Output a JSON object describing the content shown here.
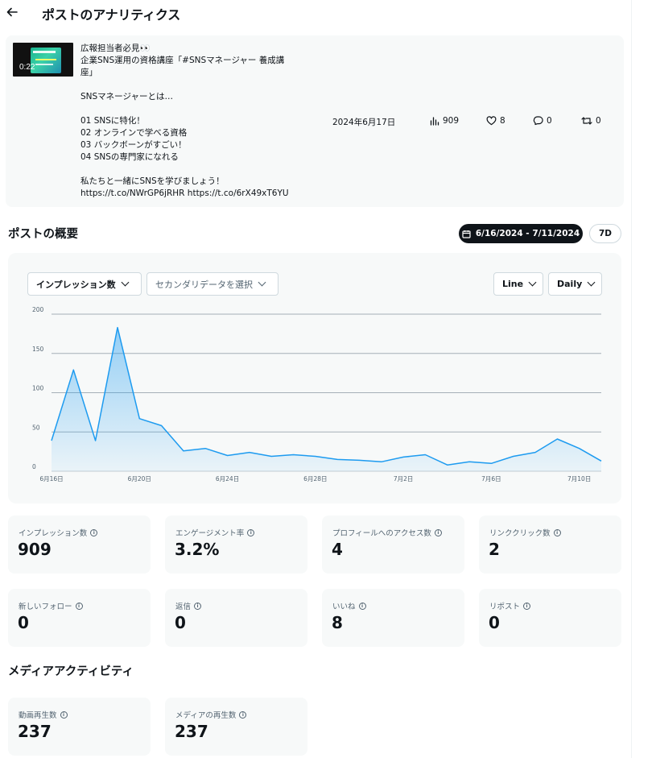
{
  "header": {
    "title": "ポストのアナリティクス"
  },
  "post": {
    "video_duration": "0:22",
    "text": "広報担当者必見👀\n企業SNS運用の資格講座「#SNSマネージャー 養成講\n座」\n\nSNSマネージャーとは…\n\n01 SNSに特化！\n02 オンラインで学べる資格\n03 バックボーンがすごい！\n04 SNSの専門家になれる\n\n私たちと一緒にSNSを学びましょう！\nhttps://t.co/NWrGP6jRHR https://t.co/6rX49xT6YU",
    "date": "2024年6月17日",
    "views": "909",
    "likes": "8",
    "replies": "0",
    "reposts": "0"
  },
  "overview": {
    "title": "ポストの概要",
    "date_range": "6/16/2024 - 7/11/2024",
    "range_button": "7D",
    "primary_metric": "インプレッション数",
    "secondary_placeholder": "セカンダリデータを選択",
    "chart_type_label": "Line",
    "interval_label": "Daily"
  },
  "chart_data": {
    "type": "area",
    "x": [
      "6月16日",
      "6月17日",
      "6月18日",
      "6月19日",
      "6月20日",
      "6月21日",
      "6月22日",
      "6月23日",
      "6月24日",
      "6月25日",
      "6月26日",
      "6月27日",
      "6月28日",
      "6月29日",
      "6月30日",
      "7月1日",
      "7月2日",
      "7月3日",
      "7月4日",
      "7月5日",
      "7月6日",
      "7月7日",
      "7月8日",
      "7月9日",
      "7月10日",
      "7月11日"
    ],
    "tick_labels": [
      "6月16日",
      "6月20日",
      "6月24日",
      "6月28日",
      "7月2日",
      "7月6日",
      "7月10日"
    ],
    "tick_indices": [
      0,
      4,
      8,
      12,
      16,
      20,
      24
    ],
    "values": [
      39,
      129,
      39,
      183,
      67,
      58,
      26,
      29,
      20,
      24,
      19,
      21,
      19,
      15,
      14,
      12,
      18,
      21,
      8,
      12,
      10,
      19,
      24,
      41,
      29,
      13
    ],
    "ylim": [
      0,
      200
    ],
    "y_ticks": [
      0,
      50,
      100,
      150,
      200
    ],
    "grid": true,
    "color": "#1d9bf0"
  },
  "metrics": [
    {
      "label": "インプレッション数",
      "value": "909"
    },
    {
      "label": "エンゲージメント率",
      "value": "3.2%"
    },
    {
      "label": "プロフィールへのアクセス数",
      "value": "4"
    },
    {
      "label": "リンククリック数",
      "value": "2"
    },
    {
      "label": "新しいフォロー",
      "value": "0"
    },
    {
      "label": "返信",
      "value": "0"
    },
    {
      "label": "いいね",
      "value": "8"
    },
    {
      "label": "リポスト",
      "value": "0"
    }
  ],
  "media": {
    "title": "メディアアクティビティ",
    "metrics": [
      {
        "label": "動画再生数",
        "value": "237"
      },
      {
        "label": "メディアの再生数",
        "value": "237"
      }
    ]
  }
}
